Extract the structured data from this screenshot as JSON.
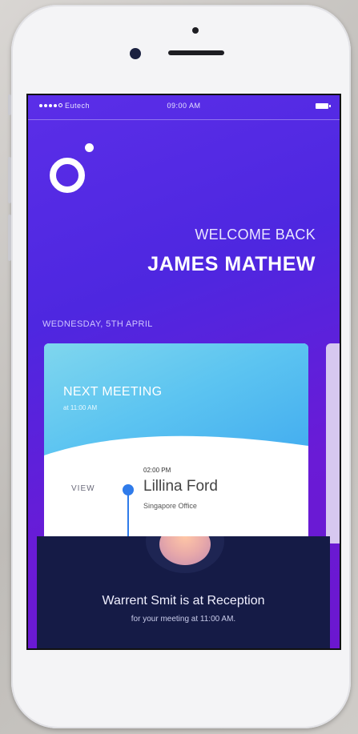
{
  "status_bar": {
    "carrier": "Eutech",
    "time": "09:00 AM"
  },
  "greeting": {
    "welcome": "WELCOME BACK",
    "name": "JAMES MATHEW"
  },
  "date": "WEDNESDAY, 5TH APRIL",
  "meeting_card": {
    "title": "NEXT MEETING",
    "time": "at 11:00 AM",
    "view_label": "VIEW",
    "slot": {
      "time": "02:00 PM",
      "name": "Lillina Ford",
      "office": "Singapore Office"
    }
  },
  "notification": {
    "title": "Warrent Smit is at Reception",
    "subtitle": "for your meeting at 11:00 AM."
  },
  "colors": {
    "screen_gradient_start": "#5b2ee8",
    "screen_gradient_end": "#6b17cf",
    "card_gradient_start": "#7fd6ee",
    "card_gradient_end": "#3ea8ef",
    "timeline_accent": "#2f7bea",
    "toast_background": "#151b46"
  },
  "icons": {
    "logo": "ring-dot-logo",
    "signal": "signal-dots-icon",
    "battery": "battery-icon"
  }
}
